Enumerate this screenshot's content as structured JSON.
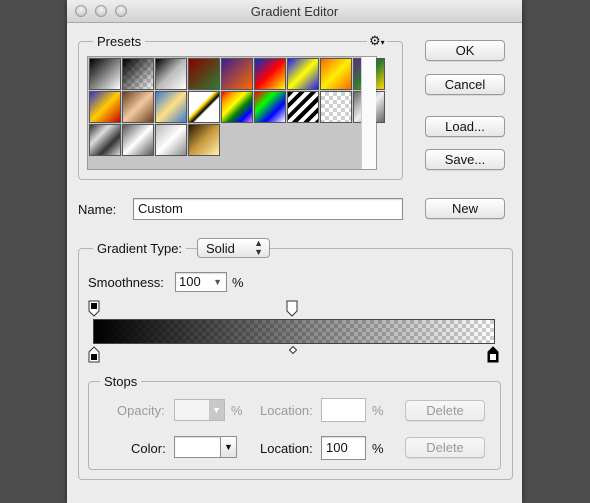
{
  "window": {
    "title": "Gradient Editor"
  },
  "presets": {
    "label": "Presets",
    "menu_icon": "gear-icon",
    "swatches": [
      {
        "css": "linear-gradient(135deg,#000,#fff)"
      },
      {
        "css": "checker-fade"
      },
      {
        "css": "linear-gradient(135deg,#000,#bbb 50%,#fff)"
      },
      {
        "css": "linear-gradient(135deg,#8b0000,#2e7d32)"
      },
      {
        "css": "linear-gradient(135deg,#3b1f8f,#ff6a00)"
      },
      {
        "css": "linear-gradient(135deg,#0033cc,#ff0000,#ffff00)"
      },
      {
        "css": "linear-gradient(135deg,#1a1aff,#ffff00,#1a1aff)"
      },
      {
        "css": "linear-gradient(135deg,#ff6600,#ffee00,#ff6600)"
      },
      {
        "css": "linear-gradient(135deg,#5b2a86,#2e7d32,#ffd700)"
      },
      {
        "css": "linear-gradient(135deg,#3333cc,#ffcc00,#cc0000)"
      },
      {
        "css": "linear-gradient(135deg,#6b3e1e,#f1c9a0,#6b3e1e)"
      },
      {
        "css": "linear-gradient(135deg,#3a7bd5,#ffe082 50%,#3a7bd5)"
      },
      {
        "css": "linear-gradient(135deg,#ffffff 40%,#ffd700 45%,#000 55%,#ffffff 60%)"
      },
      {
        "css": "linear-gradient(135deg,red,orange,yellow,green,blue,violet)"
      },
      {
        "css": "linear-gradient(135deg,#ff0000,#00ff00,#0000ff,#ffffff)"
      },
      {
        "css": "repeating-linear-gradient(135deg,#000 0 4px,#fff 4px 8px)"
      },
      {
        "css": "checker"
      },
      {
        "css": "linear-gradient(135deg,#666,#eee,#666)"
      },
      {
        "css": "linear-gradient(135deg,#333,#ddd,#333,#ddd)"
      },
      {
        "css": "linear-gradient(135deg,#555,#fff 50%,#555)"
      },
      {
        "css": "linear-gradient(135deg,#b8b8b8,#ffffff,#8a8a8a)"
      },
      {
        "css": "linear-gradient(135deg,#2a1a00,#c89a3c,#fff2b0)"
      }
    ]
  },
  "buttons": {
    "ok": "OK",
    "cancel": "Cancel",
    "load": "Load...",
    "save": "Save...",
    "new": "New"
  },
  "name": {
    "label": "Name:",
    "value": "Custom"
  },
  "gradient_type": {
    "label": "Gradient Type:",
    "value": "Solid"
  },
  "smoothness": {
    "label": "Smoothness:",
    "value": "100",
    "unit": "%"
  },
  "stops": {
    "label": "Stops",
    "opacity_label": "Opacity:",
    "opacity_value": "",
    "opacity_unit": "%",
    "opacity_location_label": "Location:",
    "opacity_location_value": "",
    "opacity_location_unit": "%",
    "opacity_delete": "Delete",
    "color_label": "Color:",
    "color_value": "#ffffff",
    "color_location_label": "Location:",
    "color_location_value": "100",
    "color_location_unit": "%",
    "color_delete": "Delete"
  },
  "gradient": {
    "start_color": "#000000",
    "end_color": "#ffffff",
    "start_opacity": 1.0,
    "end_opacity": 0.0,
    "midpoint": 0.5
  }
}
